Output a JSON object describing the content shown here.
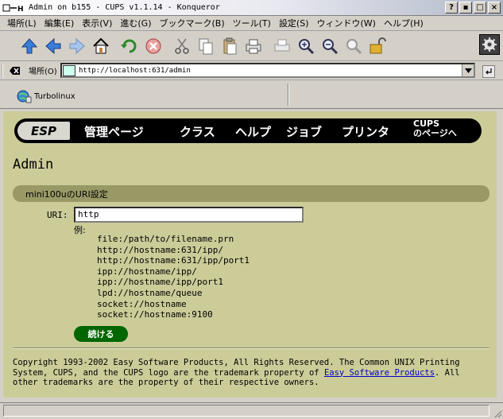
{
  "window": {
    "title": "Admin on b155 - CUPS v1.1.14 - Konqueror",
    "buttons": [
      "?",
      "▪",
      "□",
      "×"
    ]
  },
  "menubar": {
    "items": [
      "場所(L)",
      "編集(E)",
      "表示(V)",
      "進む(G)",
      "ブックマーク(B)",
      "ツール(T)",
      "設定(S)",
      "ウィンドウ(W)",
      "ヘルプ(H)"
    ]
  },
  "location": {
    "label": "場所(O)",
    "url": "http://localhost:631/admin"
  },
  "bookmarks": {
    "item": "Turbolinux"
  },
  "cups_nav": {
    "esp": "ESP",
    "links": [
      "管理ページ",
      "クラス",
      "ヘルプ",
      "ジョブ",
      "プリンタ"
    ],
    "cups_line1": "CUPS",
    "cups_line2": "のページへ"
  },
  "page": {
    "title": "Admin",
    "section": "mini100uのURI設定",
    "uri_label": "URI:",
    "uri_value": "http",
    "examples_label": "例:",
    "examples": [
      "file:/path/to/filename.prn",
      "http://hostname:631/ipp/",
      "http://hostname:631/ipp/port1",
      "ipp://hostname/ipp/",
      "ipp://hostname/ipp/port1",
      "lpd://hostname/queue",
      "socket://hostname",
      "socket://hostname:9100"
    ],
    "continue_label": "続ける"
  },
  "footer": {
    "text_before": "Copyright 1993-2002 Easy Software Products, All Rights Reserved. The Common UNIX Printing System, CUPS, and the CUPS logo are the trademark property of ",
    "link": "Easy Software Products",
    "text_after": ". All other trademarks are the property of their respective owners."
  },
  "colors": {
    "page_bg": "#cccc99",
    "section_bar": "#999966",
    "continue_button": "#006600",
    "nav_bar": "#000000"
  }
}
